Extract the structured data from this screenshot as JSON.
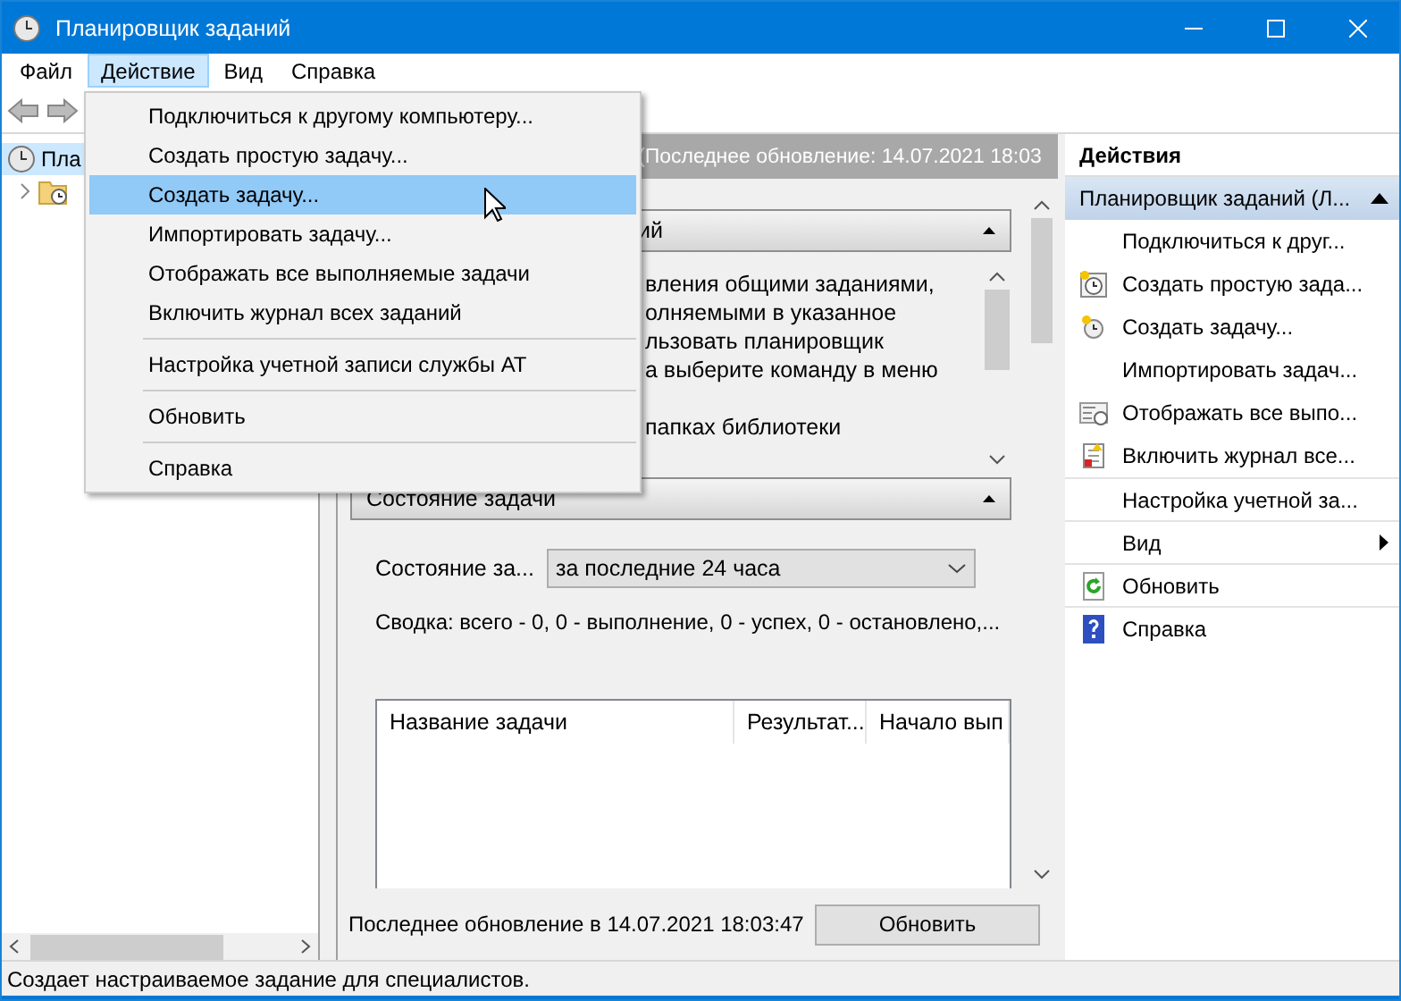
{
  "window": {
    "title": "Планировщик заданий"
  },
  "menu_bar": [
    {
      "label": "Файл",
      "selected": false
    },
    {
      "label": "Действие",
      "selected": true
    },
    {
      "label": "Вид",
      "selected": false
    },
    {
      "label": "Справка",
      "selected": false
    }
  ],
  "dropdown_menu": [
    {
      "kind": "item",
      "label": "Подключиться к другому компьютеру...",
      "selected": false
    },
    {
      "kind": "item",
      "label": "Создать простую задачу...",
      "selected": false
    },
    {
      "kind": "item",
      "label": "Создать задачу...",
      "selected": true
    },
    {
      "kind": "item",
      "label": "Импортировать задачу...",
      "selected": false
    },
    {
      "kind": "item",
      "label": "Отображать все выполняемые задачи",
      "selected": false
    },
    {
      "kind": "item",
      "label": "Включить журнал всех заданий",
      "selected": false
    },
    {
      "kind": "separator"
    },
    {
      "kind": "item",
      "label": "Настройка учетной записи службы AT",
      "selected": false
    },
    {
      "kind": "separator"
    },
    {
      "kind": "item",
      "label": "Обновить",
      "selected": false
    },
    {
      "kind": "separator"
    },
    {
      "kind": "item",
      "label": "Справка",
      "selected": false
    }
  ],
  "tree": [
    {
      "label": "Пла",
      "selected": true,
      "children": [
        {
          "selected": false,
          "expanded": false
        }
      ]
    }
  ],
  "center": {
    "header": "(Последнее обновление: 14.07.2021 18:03",
    "overview": {
      "header": "ий",
      "paragraphs": [
        [
          "вления общими заданиями,",
          "олняемыми в указанное",
          "льзовать планировщик",
          "а выберите команду в меню"
        ],
        [
          "папках библиотеки"
        ]
      ]
    },
    "status": {
      "header": "Состояние задачи",
      "filter_label": "Состояние за...",
      "filter_value": "за последние 24 часа",
      "summary": "Сводка: всего - 0, 0 - выполнение, 0 - успех, 0 - остановлено,...",
      "columns": [
        "Название задачи",
        "Результат...",
        "Начало вып"
      ]
    },
    "footer": {
      "text": "Последнее обновление в 14.07.2021 18:03:47",
      "button": "Обновить"
    }
  },
  "actions": {
    "title": "Действия",
    "group": "Планировщик заданий (Л...",
    "items": [
      {
        "kind": "item",
        "label": "Подключиться к друг..."
      },
      {
        "kind": "item",
        "label": "Создать простую зада..."
      },
      {
        "kind": "item",
        "label": "Создать задачу..."
      },
      {
        "kind": "item",
        "label": "Импортировать задач..."
      },
      {
        "kind": "item",
        "label": "Отображать все выпо..."
      },
      {
        "kind": "item",
        "label": "Включить журнал все..."
      },
      {
        "kind": "item",
        "label": "Настройка учетной за..."
      },
      {
        "kind": "submenu",
        "label": "Вид"
      },
      {
        "kind": "item",
        "label": "Обновить"
      },
      {
        "kind": "item",
        "label": "Справка"
      }
    ]
  },
  "status_bar": {
    "text": "Создает настраиваемое задание для специалистов."
  }
}
